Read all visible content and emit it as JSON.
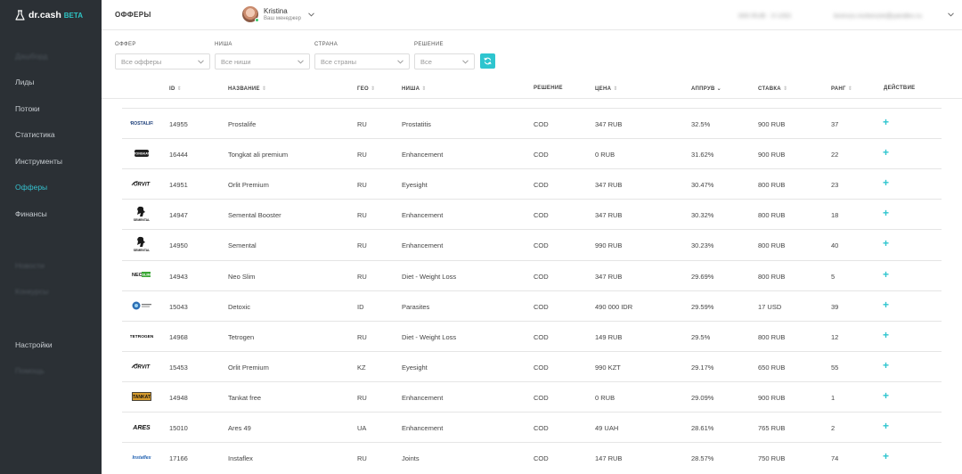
{
  "brand": {
    "name": "dr.cash",
    "badge": "BETA"
  },
  "sidebar": {
    "items": [
      {
        "label": "Дашборд",
        "state": "blurred"
      },
      {
        "label": "Лиды",
        "state": "normal"
      },
      {
        "label": "Потоки",
        "state": "normal"
      },
      {
        "label": "Статистика",
        "state": "normal"
      },
      {
        "label": "Инструменты",
        "state": "normal"
      },
      {
        "label": "Офферы",
        "state": "active"
      },
      {
        "label": "Финансы",
        "state": "normal"
      },
      {
        "label": "Новости",
        "state": "blurred"
      },
      {
        "label": "Конкурсы",
        "state": "blurred"
      },
      {
        "label": "Настройки",
        "state": "normal"
      },
      {
        "label": "Помощь",
        "state": "blurred"
      }
    ]
  },
  "header": {
    "title": "ОФФЕРЫ",
    "manager_name": "Kristina",
    "manager_role": "Ваш менеджер",
    "balance": "000 RUB · 0 USD",
    "email": "lorenzo.mckenzie@yandex.ru"
  },
  "filters": [
    {
      "label": "ОФФЕР",
      "placeholder": "Все офферы"
    },
    {
      "label": "НИША",
      "placeholder": "Все ниши"
    },
    {
      "label": "СТРАНА",
      "placeholder": "Все страны"
    },
    {
      "label": "РЕШЕНИЕ",
      "placeholder": "Все"
    }
  ],
  "table": {
    "columns": {
      "id": "ID",
      "name": "НАЗВАНИЕ",
      "geo": "ГЕО",
      "niche": "НИША",
      "decision": "РЕШЕНИЕ",
      "price": "ЦЕНА",
      "approve": "АППРУВ",
      "rate": "СТАВКА",
      "rank": "РАНГ",
      "action": "ДЕЙСТВИЕ"
    },
    "rows": [
      {
        "logo": "PROSTALIFE",
        "id": "14955",
        "name": "Prostalife",
        "geo": "RU",
        "niche": "Prostatitis",
        "decision": "COD",
        "price": "347 RUB",
        "approve": "32.5%",
        "rate": "900 RUB",
        "rank": "37",
        "action": "+"
      },
      {
        "logo": "TONGKAT",
        "id": "16444",
        "name": "Tongkat ali premium",
        "geo": "RU",
        "niche": "Enhancement",
        "decision": "COD",
        "price": "0 RUB",
        "approve": "31.62%",
        "rate": "900 RUB",
        "rank": "22",
        "action": "+"
      },
      {
        "logo": "ORLIT",
        "id": "14951",
        "name": "Orlit Premium",
        "geo": "RU",
        "niche": "Eyesight",
        "decision": "COD",
        "price": "347 RUB",
        "approve": "30.47%",
        "rate": "800 RUB",
        "rank": "23",
        "action": "+"
      },
      {
        "logo": "SEMENTAL",
        "id": "14947",
        "name": "Semental Booster",
        "geo": "RU",
        "niche": "Enhancement",
        "decision": "COD",
        "price": "347 RUB",
        "approve": "30.32%",
        "rate": "800 RUB",
        "rank": "18",
        "action": "+"
      },
      {
        "logo": "SEMENTAL",
        "id": "14950",
        "name": "Semental",
        "geo": "RU",
        "niche": "Enhancement",
        "decision": "COD",
        "price": "990 RUB",
        "approve": "30.23%",
        "rate": "800 RUB",
        "rank": "40",
        "action": "+"
      },
      {
        "logo": "NEOSLIM",
        "id": "14943",
        "name": "Neo Slim",
        "geo": "RU",
        "niche": "Diet - Weight Loss",
        "decision": "COD",
        "price": "347 RUB",
        "approve": "29.69%",
        "rate": "800 RUB",
        "rank": "5",
        "action": "+"
      },
      {
        "logo": "DETOXIC",
        "id": "15043",
        "name": "Detoxic",
        "geo": "ID",
        "niche": "Parasites",
        "decision": "COD",
        "price": "490 000 IDR",
        "approve": "29.59%",
        "rate": "17 USD",
        "rank": "39",
        "action": "+"
      },
      {
        "logo": "TETROGEN",
        "id": "14968",
        "name": "Tetrogen",
        "geo": "RU",
        "niche": "Diet - Weight Loss",
        "decision": "COD",
        "price": "149 RUB",
        "approve": "29.5%",
        "rate": "800 RUB",
        "rank": "12",
        "action": "+"
      },
      {
        "logo": "ORLIT",
        "id": "15453",
        "name": "Orlit Premium",
        "geo": "KZ",
        "niche": "Eyesight",
        "decision": "COD",
        "price": "990 KZT",
        "approve": "29.17%",
        "rate": "650 RUB",
        "rank": "55",
        "action": "+"
      },
      {
        "logo": "TANKAT",
        "id": "14948",
        "name": "Tankat free",
        "geo": "RU",
        "niche": "Enhancement",
        "decision": "COD",
        "price": "0 RUB",
        "approve": "29.09%",
        "rate": "900 RUB",
        "rank": "1",
        "action": "+"
      },
      {
        "logo": "ARES",
        "id": "15010",
        "name": "Ares 49",
        "geo": "UA",
        "niche": "Enhancement",
        "decision": "COD",
        "price": "49 UAH",
        "approve": "28.61%",
        "rate": "765 RUB",
        "rank": "2",
        "action": "+"
      },
      {
        "logo": "INSTAFLEX",
        "id": "17166",
        "name": "Instaflex",
        "geo": "RU",
        "niche": "Joints",
        "decision": "COD",
        "price": "147 RUB",
        "approve": "28.57%",
        "rate": "750 RUB",
        "rank": "74",
        "action": "+"
      }
    ]
  },
  "colors": {
    "accent": "#2ec5cf",
    "sidebar_bg": "#2b3035",
    "active_nav": "#35c2d0"
  }
}
